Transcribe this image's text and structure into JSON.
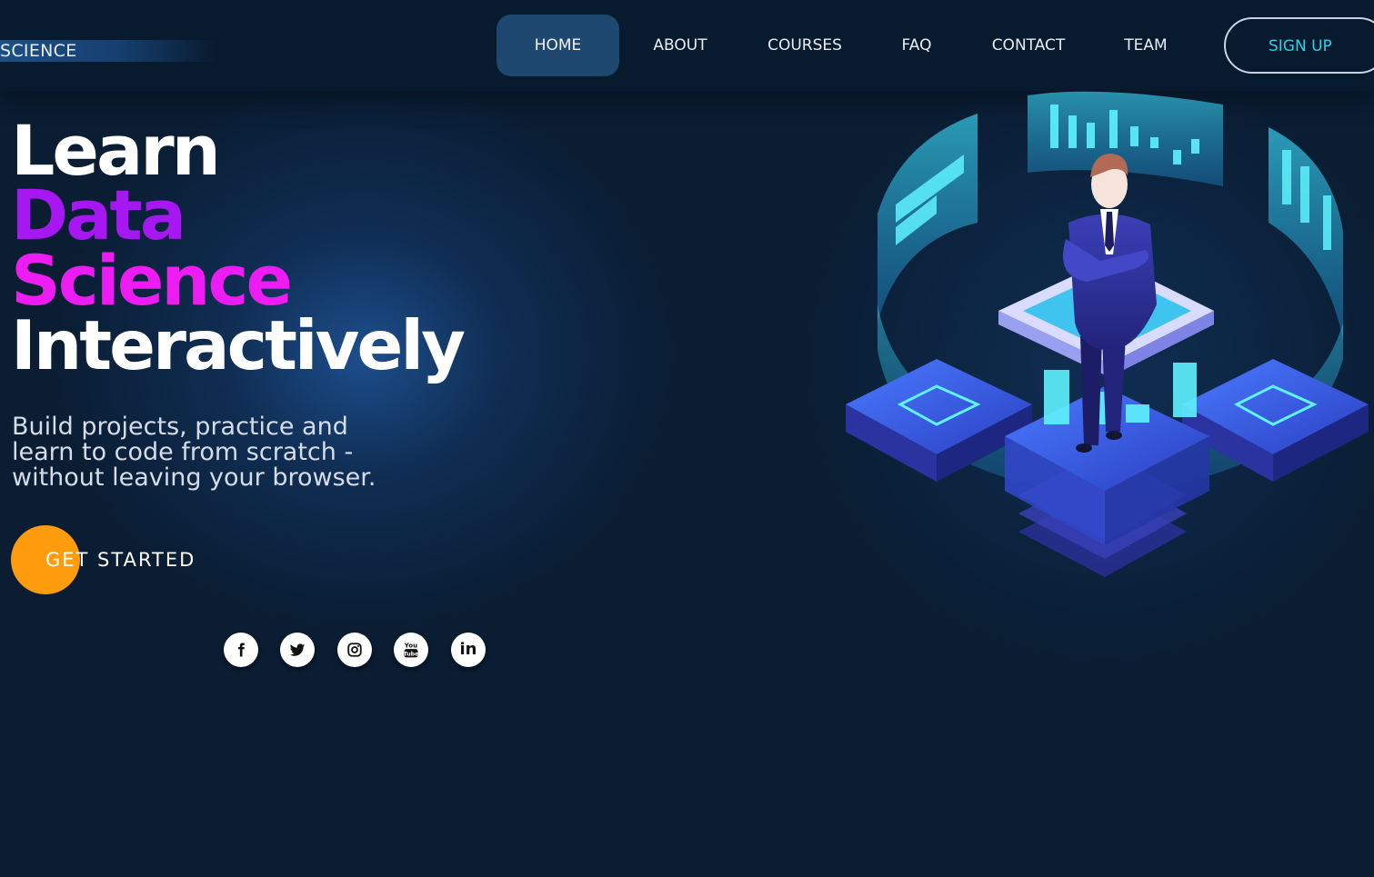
{
  "brand": {
    "text": "SCIENCE"
  },
  "nav": {
    "items": [
      {
        "label": "HOME",
        "active": true
      },
      {
        "label": "ABOUT"
      },
      {
        "label": "COURSES"
      },
      {
        "label": "FAQ"
      },
      {
        "label": "CONTACT"
      },
      {
        "label": "TEAM"
      }
    ],
    "signup_label": "SIGN UP"
  },
  "hero": {
    "line1": "Learn",
    "line2": "Data",
    "line3": "Science",
    "line4": "Interactively",
    "subtitle_lines": [
      "Build projects, practice and",
      "learn to code from scratch -",
      "without leaving your browser."
    ],
    "cta_label": "GET STARTED"
  },
  "social": {
    "icons": [
      "facebook-icon",
      "twitter-icon",
      "instagram-icon",
      "youtube-icon",
      "linkedin-icon"
    ],
    "youtube_text_top": "You",
    "youtube_text_bottom": "Tube",
    "linkedin_text": "in"
  },
  "colors": {
    "background": "#0a1d33",
    "navbar": "#081a2e",
    "nav_active": "#1e4870",
    "accent_purple": "#a617f2",
    "accent_magenta": "#ec1cf2",
    "cta_orange": "#ff9c0e",
    "signup_text": "#23d3e6"
  }
}
